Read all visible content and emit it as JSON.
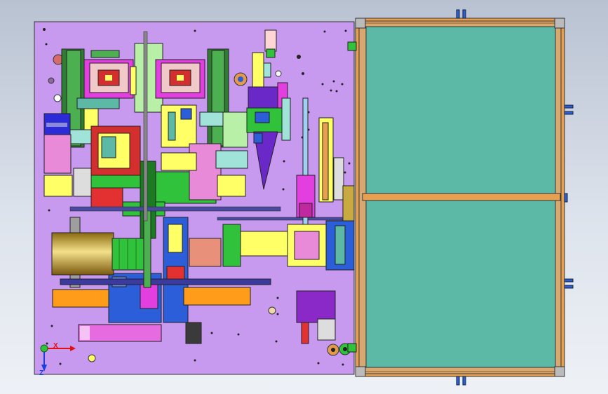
{
  "window": {
    "type": "cad-viewport",
    "view": "top"
  },
  "triad": {
    "x_label": "X",
    "z_label": "Z"
  },
  "colors": {
    "plate": "#c79af0",
    "conveyor_glass": "#5bb9a6",
    "frame_orange": "#e8a050",
    "blue": "#2b5ed8",
    "green": "#2fc23a",
    "yellow": "#ffff66",
    "magenta": "#e33fe0",
    "gold": "#c8aa40"
  },
  "model": {
    "parts": [
      "base-plate",
      "feeder-module-left",
      "feeder-module-right",
      "gold-roller",
      "blue-carriage",
      "orange-rail",
      "green-transfer-block",
      "purple-cylinder",
      "triangular-hopper",
      "conveyor-frame"
    ]
  }
}
